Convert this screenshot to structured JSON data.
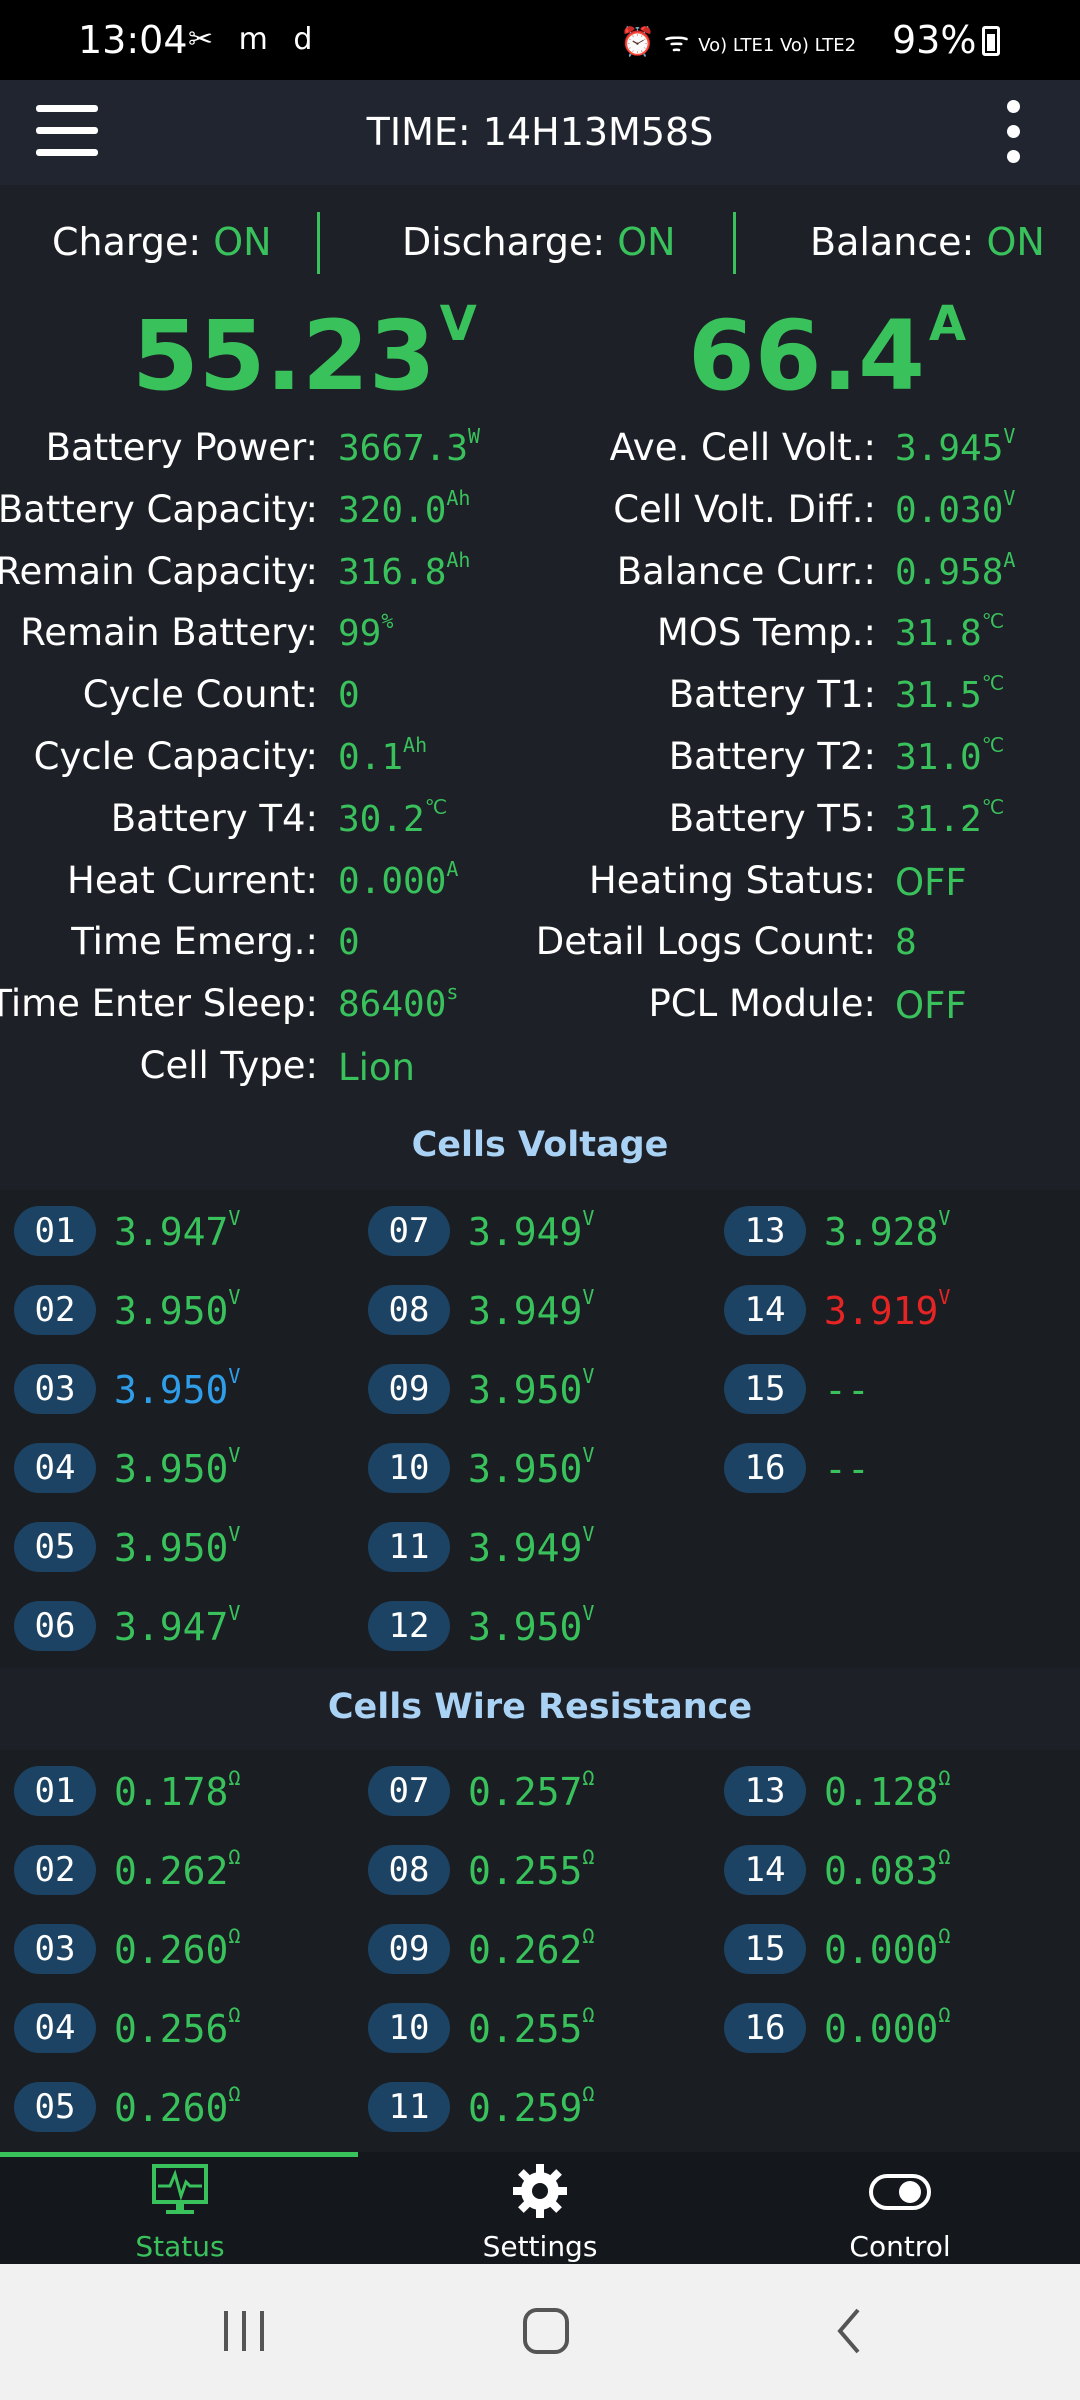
{
  "status_bar": {
    "time": "13:04",
    "left_icons": "✂ m d",
    "net": "Vo) LTE1 Vo) LTE2",
    "battery": "93%"
  },
  "app_bar": {
    "title": "TIME: 14H13M58S"
  },
  "switches": {
    "charge_label": "Charge:",
    "charge": "ON",
    "discharge_label": "Discharge:",
    "discharge": "ON",
    "balance_label": "Balance:",
    "balance": "ON"
  },
  "main": {
    "voltage": "55.23",
    "voltage_unit": "V",
    "current": "66.4",
    "current_unit": "A"
  },
  "left_stats": [
    {
      "label": "Battery Power:",
      "value": "3667.3",
      "unit": "W"
    },
    {
      "label": "Battery Capacity:",
      "value": "320.0",
      "unit": "Ah"
    },
    {
      "label": "Remain Capacity:",
      "value": "316.8",
      "unit": "Ah"
    },
    {
      "label": "Remain Battery:",
      "value": "99",
      "unit": "%"
    },
    {
      "label": "Cycle Count:",
      "value": "0",
      "unit": ""
    },
    {
      "label": "Cycle Capacity:",
      "value": "0.1",
      "unit": "Ah"
    },
    {
      "label": "Battery T4:",
      "value": "30.2",
      "unit": "℃"
    },
    {
      "label": "Heat Current:",
      "value": "0.000",
      "unit": "A"
    },
    {
      "label": "Time Emerg.:",
      "value": "0",
      "unit": ""
    },
    {
      "label": "Time Enter Sleep:",
      "value": "86400",
      "unit": "s"
    },
    {
      "label": "Cell Type:",
      "value": "Lion",
      "unit": ""
    }
  ],
  "right_stats": [
    {
      "label": "Ave. Cell Volt.:",
      "value": "3.945",
      "unit": "V"
    },
    {
      "label": "Cell Volt. Diff.:",
      "value": "0.030",
      "unit": "V"
    },
    {
      "label": "Balance Curr.:",
      "value": "0.958",
      "unit": "A"
    },
    {
      "label": "MOS Temp.:",
      "value": "31.8",
      "unit": "℃"
    },
    {
      "label": "Battery T1:",
      "value": "31.5",
      "unit": "℃"
    },
    {
      "label": "Battery T2:",
      "value": "31.0",
      "unit": "℃"
    },
    {
      "label": "Battery T5:",
      "value": "31.2",
      "unit": "℃"
    },
    {
      "label": "Heating Status:",
      "value": "OFF",
      "unit": ""
    },
    {
      "label": "Detail Logs Count:",
      "value": "8",
      "unit": ""
    },
    {
      "label": "PCL Module:",
      "value": "OFF",
      "unit": ""
    }
  ],
  "cells_voltage": {
    "title": "Cells Voltage",
    "unit": "V",
    "cells": [
      {
        "id": "01",
        "value": "3.947",
        "state": "normal"
      },
      {
        "id": "02",
        "value": "3.950",
        "state": "normal"
      },
      {
        "id": "03",
        "value": "3.950",
        "state": "max"
      },
      {
        "id": "04",
        "value": "3.950",
        "state": "normal"
      },
      {
        "id": "05",
        "value": "3.950",
        "state": "normal"
      },
      {
        "id": "06",
        "value": "3.947",
        "state": "normal"
      },
      {
        "id": "07",
        "value": "3.949",
        "state": "normal"
      },
      {
        "id": "08",
        "value": "3.949",
        "state": "normal"
      },
      {
        "id": "09",
        "value": "3.950",
        "state": "normal"
      },
      {
        "id": "10",
        "value": "3.950",
        "state": "normal"
      },
      {
        "id": "11",
        "value": "3.949",
        "state": "normal"
      },
      {
        "id": "12",
        "value": "3.950",
        "state": "normal"
      },
      {
        "id": "13",
        "value": "3.928",
        "state": "normal"
      },
      {
        "id": "14",
        "value": "3.919",
        "state": "min"
      },
      {
        "id": "15",
        "value": "--",
        "state": "empty"
      },
      {
        "id": "16",
        "value": "--",
        "state": "empty"
      }
    ]
  },
  "cells_resistance": {
    "title": "Cells Wire Resistance",
    "unit": "Ω",
    "cells": [
      {
        "id": "01",
        "value": "0.178"
      },
      {
        "id": "02",
        "value": "0.262"
      },
      {
        "id": "03",
        "value": "0.260"
      },
      {
        "id": "04",
        "value": "0.256"
      },
      {
        "id": "05",
        "value": "0.260"
      },
      {
        "id": "07",
        "value": "0.257"
      },
      {
        "id": "08",
        "value": "0.255"
      },
      {
        "id": "09",
        "value": "0.262"
      },
      {
        "id": "10",
        "value": "0.255"
      },
      {
        "id": "11",
        "value": "0.259"
      },
      {
        "id": "13",
        "value": "0.128"
      },
      {
        "id": "14",
        "value": "0.083"
      },
      {
        "id": "15",
        "value": "0.000"
      },
      {
        "id": "16",
        "value": "0.000"
      }
    ]
  },
  "bottom_nav": [
    {
      "label": "Status",
      "icon": "monitor-pulse-icon",
      "active": true
    },
    {
      "label": "Settings",
      "icon": "gear-icon",
      "active": false
    },
    {
      "label": "Control",
      "icon": "toggle-icon",
      "active": false
    }
  ],
  "colors": {
    "accent": "#39c15c",
    "max_cell": "#2f9de8",
    "min_cell": "#e52424",
    "badge": "#1c4363",
    "section_title": "#a9d2f5"
  }
}
